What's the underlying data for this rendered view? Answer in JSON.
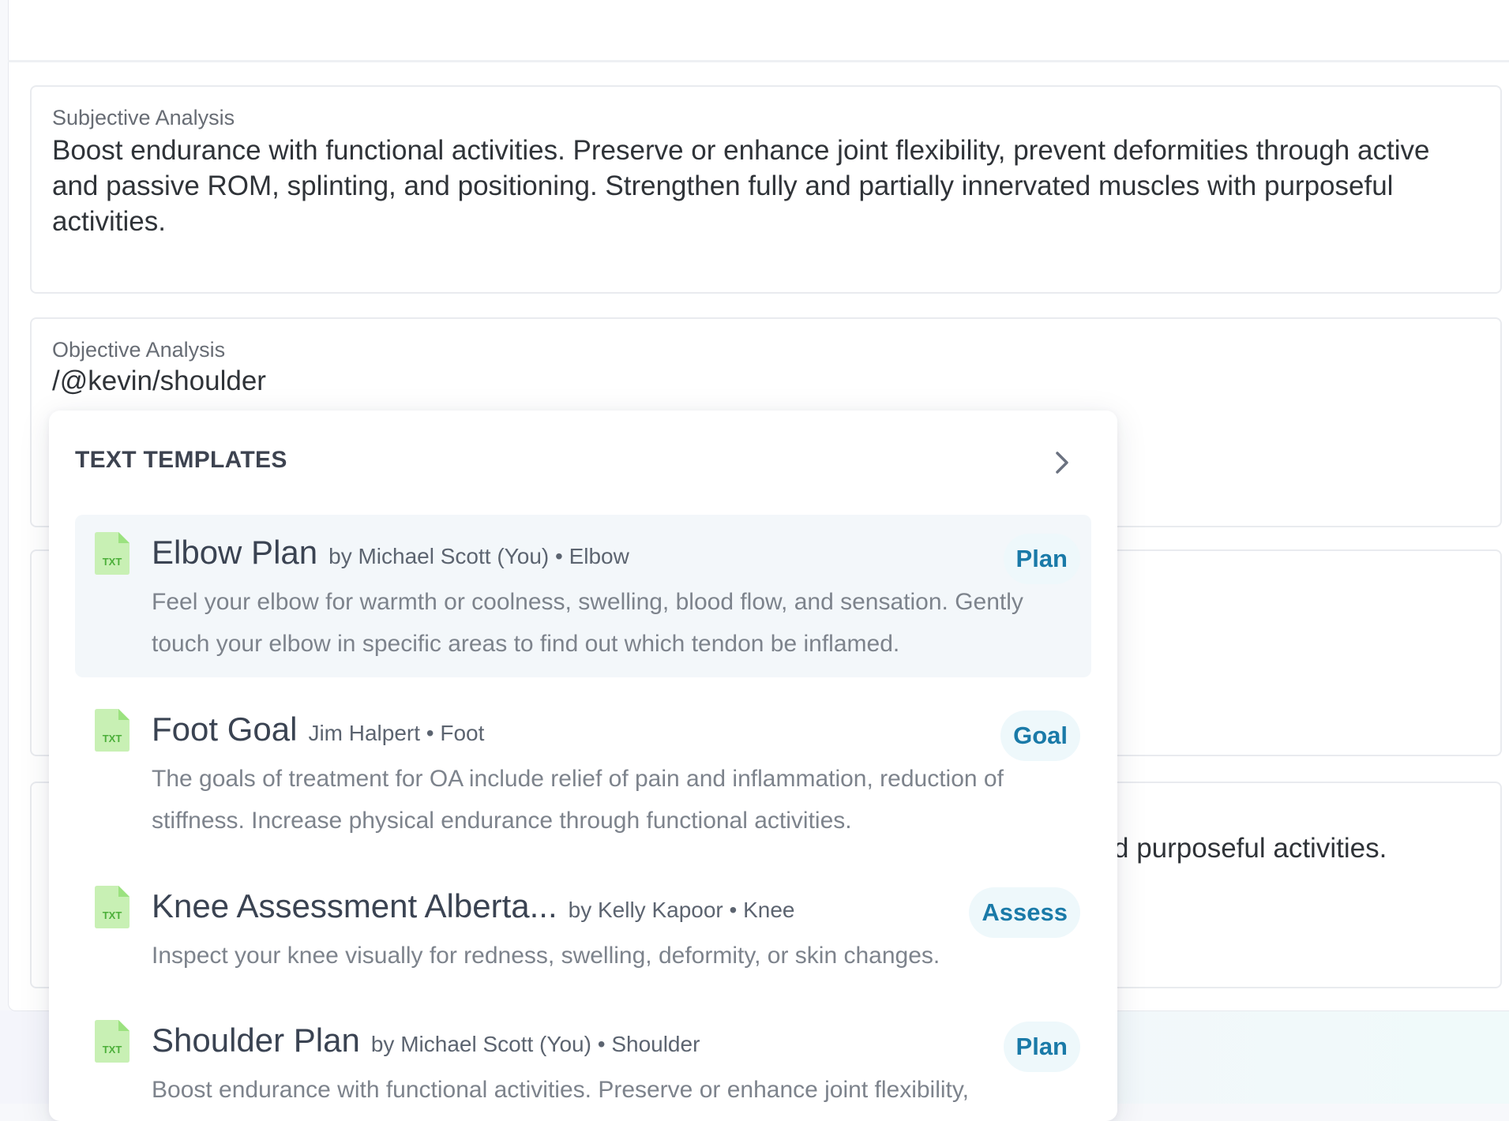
{
  "colors": {
    "accent": "#1a7aa8",
    "badge_bg": "#eef8fb",
    "txt_icon": "#9be27f",
    "active_row": "#f3f7fa"
  },
  "fields": {
    "subjective": {
      "label": "Subjective Analysis",
      "value": "Boost endurance with functional activities. Preserve or enhance joint flexibility, prevent deformities through active and passive ROM, splinting, and positioning. Strengthen fully and partially innervated muscles with purposeful activities."
    },
    "objective": {
      "label": "Objective Analysis",
      "value": "/@kevin/shoulder"
    },
    "background_peek": "d purposeful activities."
  },
  "dropdown": {
    "header": "TEXT TEMPLATES",
    "chevron_icon": "chevron-right-icon",
    "file_icon": "txt-file-icon",
    "file_icon_text": "TXT",
    "items": [
      {
        "title": "Elbow Plan",
        "meta": "by Michael Scott (You) • Elbow",
        "badge": "Plan",
        "description": "Feel your elbow for warmth or coolness, swelling, blood flow, and sensation. Gently touch your elbow in specific areas to find out which tendon be inflamed."
      },
      {
        "title": "Foot Goal",
        "meta": "Jim Halpert • Foot",
        "badge": "Goal",
        "description": "The goals of treatment for OA include relief of pain and inflammation, reduction of stiffness. Increase physical endurance through functional activities."
      },
      {
        "title": "Knee Assessment Alberta...",
        "meta": "by Kelly Kapoor • Knee",
        "badge": "Assess",
        "description": "Inspect your knee visually for redness, swelling, deformity, or skin changes."
      },
      {
        "title": "Shoulder Plan",
        "meta": "by Michael Scott (You) • Shoulder",
        "badge": "Plan",
        "description": "Boost endurance with functional activities. Preserve or enhance joint flexibility,"
      }
    ]
  }
}
